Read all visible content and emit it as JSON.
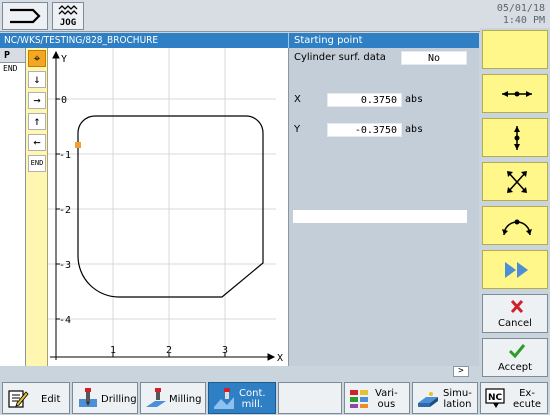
{
  "status_bar": {
    "date": "05/01/18",
    "time": "1:40 PM",
    "mode_label": "JOG"
  },
  "header": {
    "program_path": "NC/WKS/TESTING/828_BROCHURE",
    "panel_title": "Starting point"
  },
  "program_list": {
    "header": "P",
    "rows": [
      "END"
    ]
  },
  "element_toolbar": {
    "items": [
      {
        "icon": "crosshair-icon",
        "glyph": "⌖",
        "selected": true
      },
      {
        "icon": "arrow-down-icon",
        "glyph": "↓"
      },
      {
        "icon": "arrow-right-icon",
        "glyph": "→"
      },
      {
        "icon": "arrow-up-icon",
        "glyph": "↑"
      },
      {
        "icon": "arrow-left-icon",
        "glyph": "←"
      },
      {
        "icon": "end-icon",
        "glyph": "END"
      }
    ]
  },
  "graphics": {
    "x_axis_label": "X",
    "y_axis_label": "Y",
    "x_ticks": [
      "1",
      "2",
      "3"
    ],
    "y_ticks": [
      "0",
      "-1",
      "-2",
      "-3",
      "-4"
    ],
    "contour_color": "#000000",
    "start_point_color": "#f0a030"
  },
  "params": {
    "cylinder_label": "Cylinder surf. data",
    "cylinder_value": "No",
    "x_label": "X",
    "x_value": "0.3750",
    "x_unit": "abs",
    "y_label": "Y",
    "y_value": "-0.3750",
    "y_unit": "abs",
    "scroll_glyph": ">"
  },
  "vertical_softkeys": [
    {
      "icon": "blank",
      "label": ""
    },
    {
      "icon": "tangent-horizontal-icon",
      "label": ""
    },
    {
      "icon": "tangent-vertical-icon",
      "label": ""
    },
    {
      "icon": "diagonal-arrows-icon",
      "label": ""
    },
    {
      "icon": "arc-icon",
      "label": ""
    },
    {
      "icon": "double-arrow-right-icon",
      "label": ""
    },
    {
      "icon": "cancel-icon",
      "label": "Cancel"
    },
    {
      "icon": "accept-icon",
      "label": "Accept"
    }
  ],
  "horizontal_softkeys": {
    "edit": "Edit",
    "drilling": "Drilling",
    "milling": "Milling",
    "cont_mill_1": "Cont.",
    "cont_mill_2": "mill.",
    "various_1": "Vari-",
    "various_2": "ous",
    "simulation_1": "Simu-",
    "simulation_2": "lation",
    "execute_1": "Ex-",
    "execute_2": "ecute"
  },
  "colors": {
    "accent_blue": "#2e7fc3",
    "softkey_yellow": "#fff78a",
    "cancel_red": "#d0202a",
    "accept_green": "#2a9d2a"
  }
}
